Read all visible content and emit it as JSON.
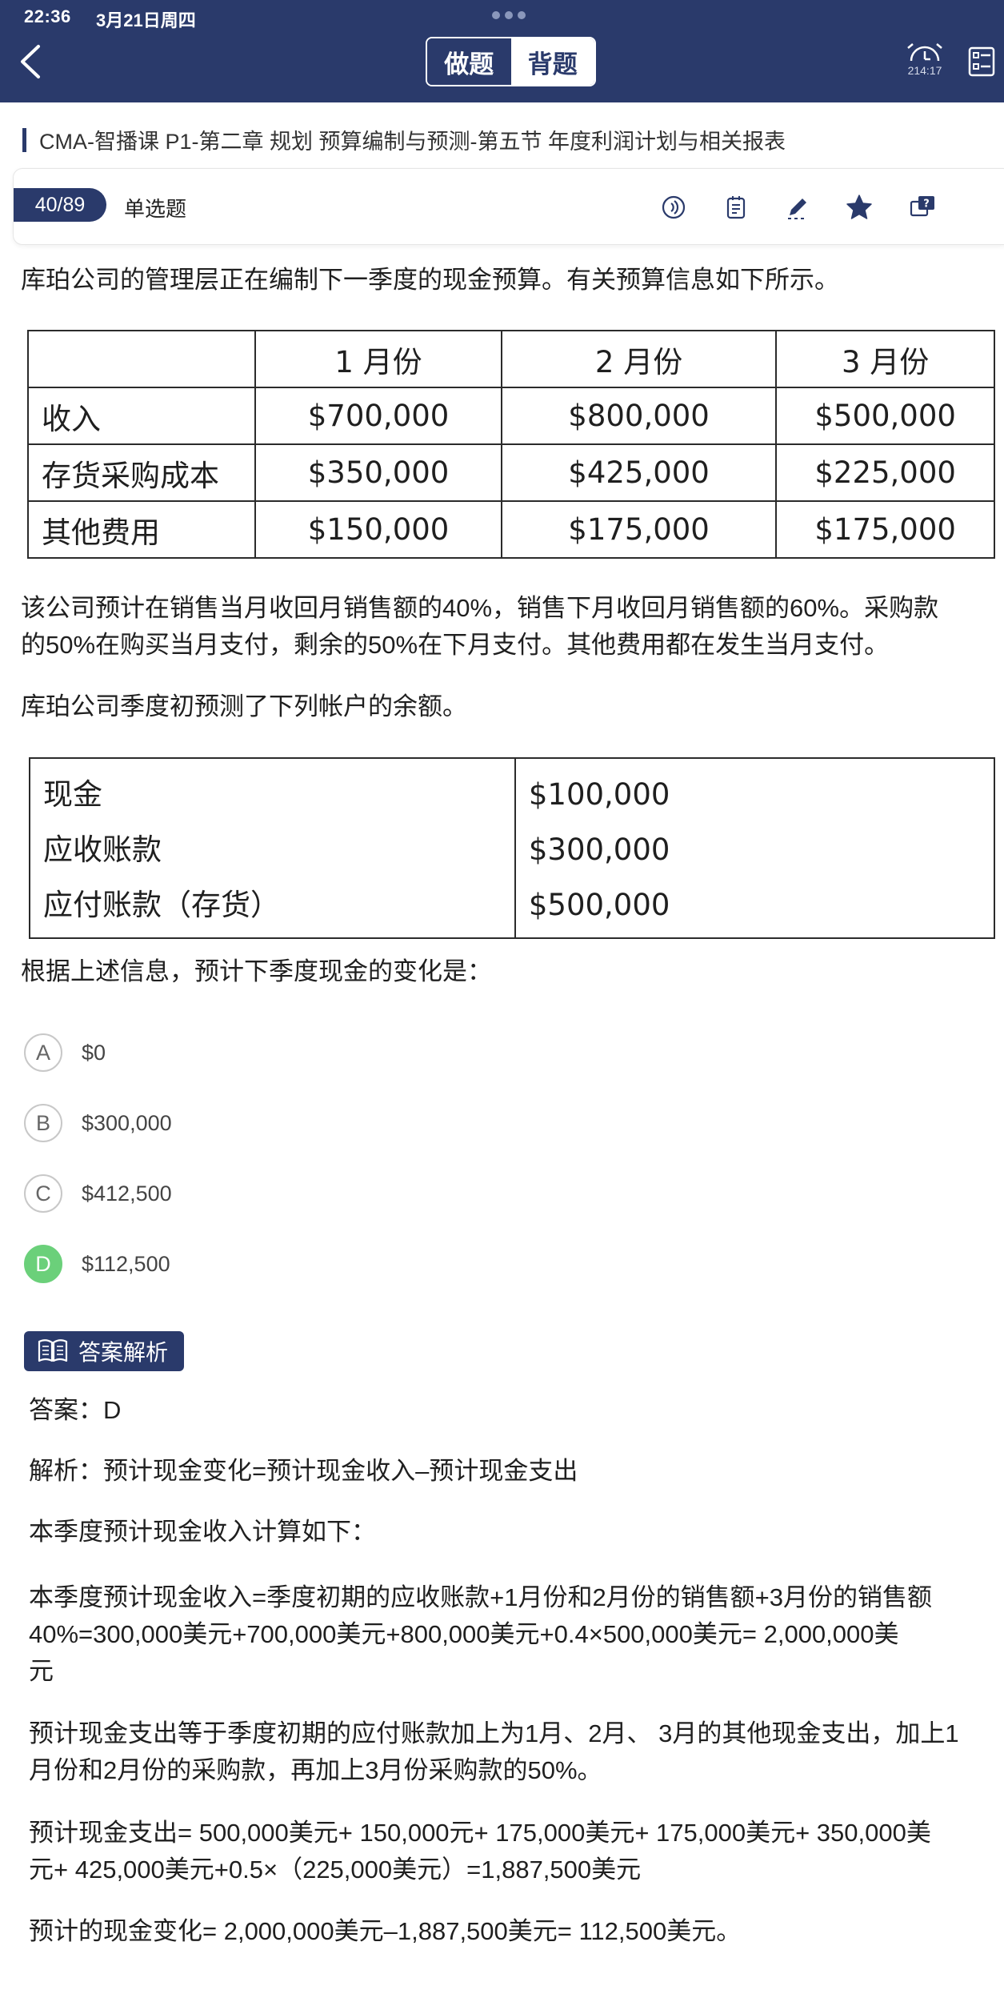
{
  "status": {
    "time": "22:36",
    "date": "3月21日周四"
  },
  "header": {
    "tab_practice": "做题",
    "tab_review": "背题",
    "timer": "214:17",
    "icons": [
      "back-chevron-icon",
      "alarm-clock-icon",
      "answer-card-icon"
    ]
  },
  "breadcrumb": "CMA-智播课 P1-第二章 规划 预算编制与预测-第五节 年度利润计划与相关报表",
  "question_bar": {
    "number": "40/89",
    "type": "单选题",
    "tools": [
      "audio-icon",
      "notes-icon",
      "edit-icon",
      "star-icon",
      "question-feedback-icon"
    ]
  },
  "question": {
    "intro": "库珀公司的管理层正在编制下一季度的现金预算。有关预算信息如下所示。",
    "table1": {
      "headers": [
        "",
        "1 月份",
        "2 月份",
        "3 月份"
      ],
      "rows": [
        [
          "收入",
          "$700,000",
          "$800,000",
          "$500,000"
        ],
        [
          "存货采购成本",
          "$350,000",
          "$425,000",
          "$225,000"
        ],
        [
          "其他费用",
          "$150,000",
          "$175,000",
          "$175,000"
        ]
      ]
    },
    "p2_line1": "该公司预计在销售当月收回月销售额的40%，销售下月收回月销售额的60%。采购款",
    "p2_line2": "的50%在购买当月支付，剩余的50%在下月支付。其他费用都在发生当月支付。",
    "p3": "库珀公司季度初预测了下列帐户的余额。",
    "table2": {
      "labels": [
        "现金",
        "应收账款",
        "应付账款（存货）"
      ],
      "values": [
        "$100,000",
        "$300,000",
        "$500,000"
      ]
    },
    "prompt": "根据上述信息，预计下季度现金的变化是："
  },
  "options": [
    {
      "key": "A",
      "text": "$0"
    },
    {
      "key": "B",
      "text": "$300,000"
    },
    {
      "key": "C",
      "text": "$412,500"
    },
    {
      "key": "D",
      "text": "$112,500"
    }
  ],
  "selected_option": "D",
  "colors": {
    "navy": "#2a3a6b",
    "correct": "#6bd07a"
  },
  "analysis": {
    "badge": "答案解析",
    "answer": "答案：D",
    "formula": "解析：预计现金变化=预计现金收入–预计现金支出",
    "intro": "本季度预计现金收入计算如下：",
    "income_l1": "本季度预计现金收入=季度初期的应收账款+1月份和2月份的销售额+3月份的销售额",
    "income_l2": "40%=300,000美元+700,000美元+800,000美元+0.4×500,000美元= 2,000,000美",
    "income_l3": "元",
    "out_desc_l1": "预计现金支出等于季度初期的应付账款加上为1月、2月、 3月的其他现金支出，加上1",
    "out_desc_l2": "月份和2月份的采购款，再加上3月份采购款的50%。",
    "out_calc_l1": "预计现金支出= 500,000美元+ 150,000元+ 175,000美元+ 175,000美元+ 350,000美",
    "out_calc_l2": "元+ 425,000美元+0.5×（225,000美元）=1,887,500美元",
    "result": "预计的现金变化= 2,000,000美元–1,887,500美元= 112,500美元。"
  }
}
